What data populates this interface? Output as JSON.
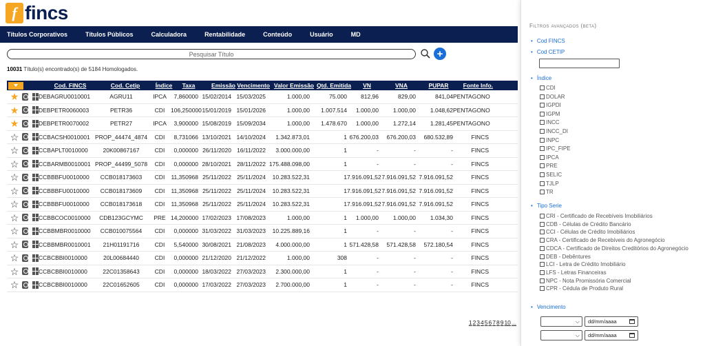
{
  "brand": {
    "logo_letter": "f",
    "name": "fincs"
  },
  "nav": [
    "Títulos Corporativos",
    "Títulos Públicos",
    "Calculadora",
    "Rentabilidade",
    "Conteúdo",
    "Usuário",
    "MD"
  ],
  "search": {
    "placeholder": "Pesquisar Título"
  },
  "results": {
    "count": "10031",
    "text": " Título(s) encontrado(s) de 5184 Homologados."
  },
  "table": {
    "headers": [
      "Cod. FINCS",
      "Cod. Cetip",
      "Índice",
      "Taxa",
      "Emissão",
      "Vencimento",
      "Valor Emissão",
      "Qtd. Emitida",
      "VN",
      "VNA",
      "PUPAR",
      "Fonte Info."
    ],
    "rows": [
      {
        "fav": true,
        "fincs": "DEBAGRU0010001",
        "cetip": "AGRU11",
        "ind": "IPCA",
        "taxa": "7,860000",
        "emi": "15/02/2014",
        "ven": "15/03/2025",
        "vemi": "1.000,00",
        "qtd": "75.000",
        "vn": "812,96",
        "vna": "829,00",
        "pupar": "841,04",
        "fonte": "PENTAGONO"
      },
      {
        "fav": true,
        "fincs": "DEBPETR0060003",
        "cetip": "PETR36",
        "ind": "CDI",
        "taxa": "106,250000",
        "emi": "15/01/2019",
        "ven": "15/01/2026",
        "vemi": "1.000,00",
        "qtd": "1.007.514",
        "vn": "1.000,00",
        "vna": "1.000,00",
        "pupar": "1.048,62",
        "fonte": "PENTAGONO"
      },
      {
        "fav": true,
        "fincs": "DEBPETR0070002",
        "cetip": "PETR27",
        "ind": "IPCA",
        "taxa": "3,900000",
        "emi": "15/08/2019",
        "ven": "15/09/2034",
        "vemi": "1.000,00",
        "qtd": "1.478.670",
        "vn": "1.000,00",
        "vna": "1.272,14",
        "pupar": "1.281,45",
        "fonte": "PENTAGONO"
      },
      {
        "fav": false,
        "fincs": "CCBACSH0010001",
        "cetip": "PROP_44474_4874",
        "ind": "CDI",
        "taxa": "8,731066",
        "emi": "13/10/2021",
        "ven": "14/10/2024",
        "vemi": "1.342.873,01",
        "qtd": "1",
        "vn": "676.200,03",
        "vna": "676.200,03",
        "pupar": "680.532,89",
        "fonte": "FINCS"
      },
      {
        "fav": false,
        "fincs": "CCBAPLT0010000",
        "cetip": "20K00867167",
        "ind": "CDI",
        "taxa": "0,000000",
        "emi": "26/11/2020",
        "ven": "16/11/2022",
        "vemi": "3.000.000,00",
        "qtd": "1",
        "vn": "-",
        "vna": "-",
        "pupar": "-",
        "fonte": "FINCS"
      },
      {
        "fav": false,
        "fincs": "CCBARMB0010001",
        "cetip": "PROP_44499_5078",
        "ind": "CDI",
        "taxa": "0,000000",
        "emi": "28/10/2021",
        "ven": "28/11/2022",
        "vemi": "175.488.098,00",
        "qtd": "1",
        "vn": "-",
        "vna": "-",
        "pupar": "-",
        "fonte": "FINCS"
      },
      {
        "fav": false,
        "fincs": "CCBBBFU0010000",
        "cetip": "CCB018173603",
        "ind": "CDI",
        "taxa": "11,350968",
        "emi": "25/11/2022",
        "ven": "25/11/2024",
        "vemi": "10.283.522,31",
        "qtd": "1",
        "vn": "7.916.091,52",
        "vna": "7.916.091,52",
        "pupar": "7.916.091,52",
        "fonte": "FINCS"
      },
      {
        "fav": false,
        "fincs": "CCBBBFU0010000",
        "cetip": "CCB018173609",
        "ind": "CDI",
        "taxa": "11,350968",
        "emi": "25/11/2022",
        "ven": "25/11/2024",
        "vemi": "10.283.522,31",
        "qtd": "1",
        "vn": "7.916.091,52",
        "vna": "7.916.091,52",
        "pupar": "7.916.091,52",
        "fonte": "FINCS"
      },
      {
        "fav": false,
        "fincs": "CCBBBFU0010000",
        "cetip": "CCB018173618",
        "ind": "CDI",
        "taxa": "11,350968",
        "emi": "25/11/2022",
        "ven": "25/11/2024",
        "vemi": "10.283.522,31",
        "qtd": "1",
        "vn": "7.916.091,52",
        "vna": "7.916.091,52",
        "pupar": "7.916.091,52",
        "fonte": "FINCS"
      },
      {
        "fav": false,
        "fincs": "CCBBCOC0010000",
        "cetip": "CDB123GCYMC",
        "ind": "PRE",
        "taxa": "14,200000",
        "emi": "17/02/2023",
        "ven": "17/08/2023",
        "vemi": "1.000,00",
        "qtd": "1",
        "vn": "1.000,00",
        "vna": "1.000,00",
        "pupar": "1.034,30",
        "fonte": "FINCS"
      },
      {
        "fav": false,
        "fincs": "CCBBMBR0010000",
        "cetip": "CCB010075564",
        "ind": "CDI",
        "taxa": "0,000000",
        "emi": "31/03/2022",
        "ven": "31/03/2023",
        "vemi": "10.225.889,16",
        "qtd": "1",
        "vn": "-",
        "vna": "-",
        "pupar": "-",
        "fonte": "FINCS"
      },
      {
        "fav": false,
        "fincs": "CCBBMBR0010001",
        "cetip": "21H01191716",
        "ind": "CDI",
        "taxa": "5,540000",
        "emi": "30/08/2021",
        "ven": "21/08/2023",
        "vemi": "4.000.000,00",
        "qtd": "1",
        "vn": "571.428,58",
        "vna": "571.428,58",
        "pupar": "572.180,54",
        "fonte": "FINCS"
      },
      {
        "fav": false,
        "fincs": "CCBCBBI0010000",
        "cetip": "20L00684440",
        "ind": "CDI",
        "taxa": "0,000000",
        "emi": "21/12/2020",
        "ven": "21/12/2022",
        "vemi": "1.000,00",
        "qtd": "308",
        "vn": "-",
        "vna": "-",
        "pupar": "-",
        "fonte": "FINCS"
      },
      {
        "fav": false,
        "fincs": "CCBCBBI0010000",
        "cetip": "22C01358643",
        "ind": "CDI",
        "taxa": "0,000000",
        "emi": "18/03/2022",
        "ven": "27/03/2023",
        "vemi": "2.300.000,00",
        "qtd": "1",
        "vn": "-",
        "vna": "-",
        "pupar": "-",
        "fonte": "FINCS"
      },
      {
        "fav": false,
        "fincs": "CCBCBBI0010000",
        "cetip": "22C01652605",
        "ind": "CDI",
        "taxa": "0,000000",
        "emi": "17/03/2022",
        "ven": "27/03/2023",
        "vemi": "2.700.000,00",
        "qtd": "1",
        "vn": "-",
        "vna": "-",
        "pupar": "-",
        "fonte": "FINCS"
      }
    ]
  },
  "pagination": [
    "1",
    "2",
    "3",
    "4",
    "5",
    "6",
    "7",
    "8",
    "9",
    "10",
    "..."
  ],
  "sidebar": {
    "title": "Filtros avançados (beta)",
    "cod_fincs": "Cod FINCS",
    "cod_cetip": "Cod CETIP",
    "indice_label": "Índice",
    "indices": [
      "CDI",
      "DOLAR",
      "IGPDI",
      "IGPM",
      "INCC",
      "INCC_DI",
      "INPC",
      "IPC_FIPE",
      "IPCA",
      "PRE",
      "SELIC",
      "TJLP",
      "TR"
    ],
    "tipo_label": "Tipo Serie",
    "tipos": [
      "CRI - Certificado de Recebíveis Imobiliários",
      "CDB - Células de Crédito Bancário",
      "CCI - Células de Crédito Imobiliários",
      "CRA - Certificado de Recebíveis do Agronegócio",
      "CDCA - Certificado de Direitos Creditórios do Agronegócio",
      "DEB - Debêntures",
      "LCI - Letra de Crédito Imobiliário",
      "LFS - Letras Financeiras",
      "NPC - Nota Promissória Comercial",
      "CPR - Cédula de Produto Rural"
    ],
    "vencimento_label": "Vencimento",
    "date_placeholder": "dd/mm/aaaa"
  },
  "colors": {
    "navy": "#0b2050",
    "orange": "#f5a623",
    "link_blue": "#1a6ed8"
  }
}
